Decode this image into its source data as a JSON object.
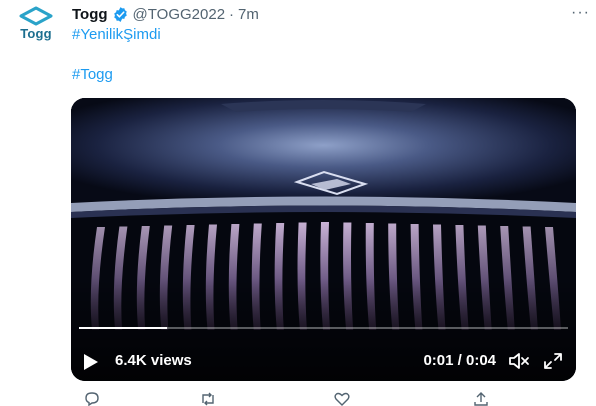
{
  "tweet": {
    "display_name": "Togg",
    "handle": "@TOGG2022",
    "separator": "·",
    "time": "7m",
    "more_label": "···",
    "avatar_word": "Togg",
    "hashtags": [
      "#YenilikŞimdi",
      "#Togg"
    ]
  },
  "video": {
    "views": "6.4K views",
    "timecode": "0:01 / 0:04",
    "progress": 0.18
  },
  "colors": {
    "accent": "#1d9bf0",
    "brand": "#1c6e8f",
    "secondary_text": "#536471"
  }
}
